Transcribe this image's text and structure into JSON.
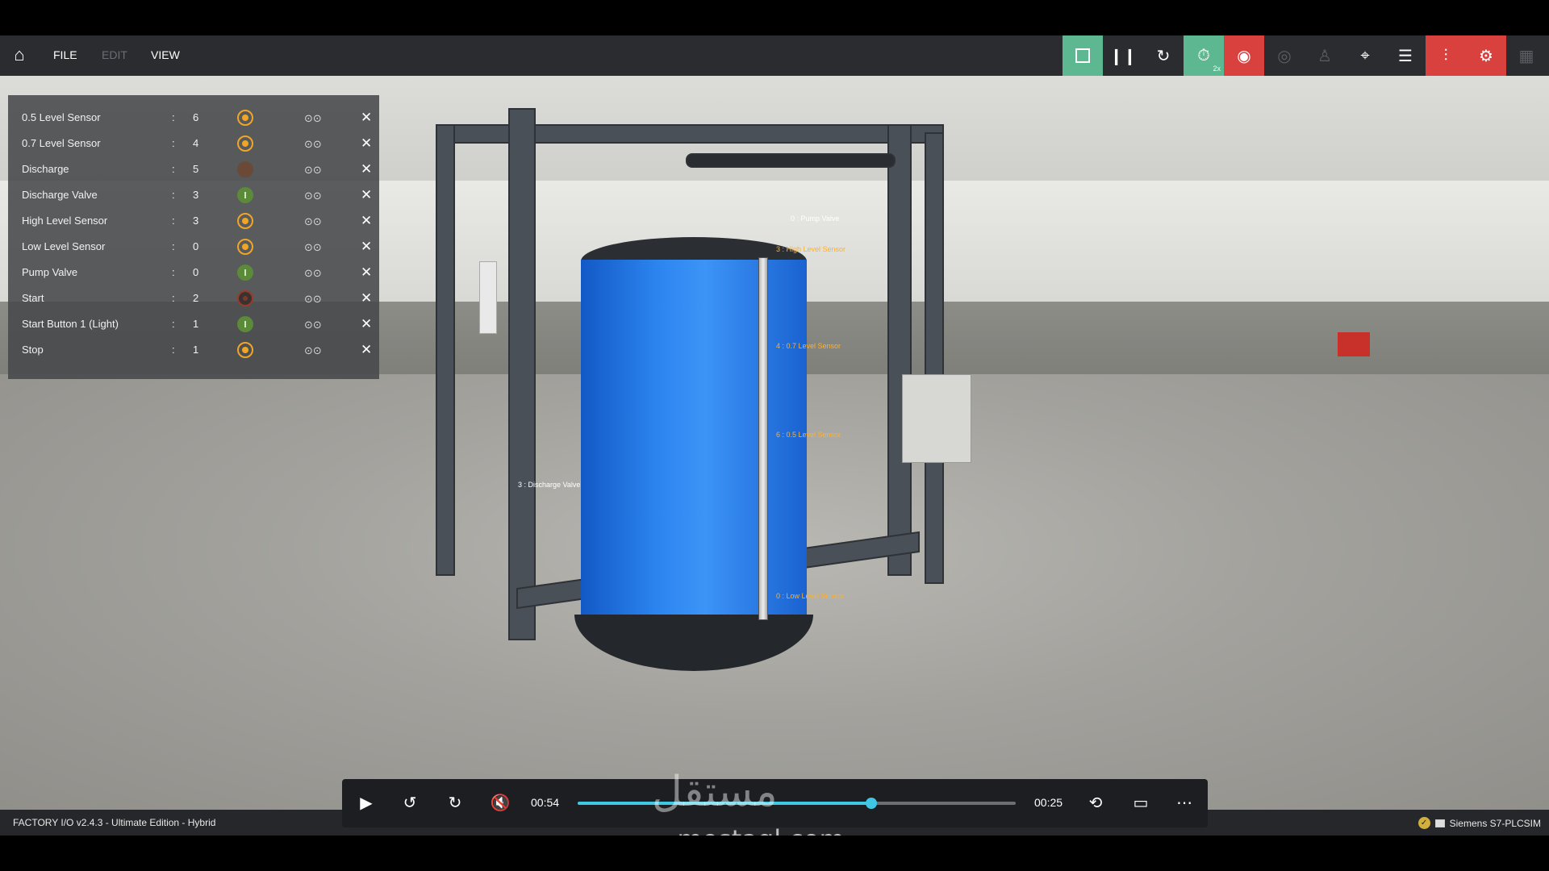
{
  "toolbar": {
    "menus": [
      {
        "label": "FILE",
        "enabled": true
      },
      {
        "label": "EDIT",
        "enabled": false
      },
      {
        "label": "VIEW",
        "enabled": true
      }
    ],
    "speed_badge": "2x",
    "accent_green": "#5db891",
    "accent_red": "#d9413f"
  },
  "tags": [
    {
      "name": "0.5 Level Sensor",
      "value": "6",
      "indicator": "orange"
    },
    {
      "name": "0.7 Level Sensor",
      "value": "4",
      "indicator": "orange"
    },
    {
      "name": "Discharge",
      "value": "5",
      "indicator": "off"
    },
    {
      "name": "Discharge Valve",
      "value": "3",
      "indicator": "green"
    },
    {
      "name": "High Level Sensor",
      "value": "3",
      "indicator": "orange"
    },
    {
      "name": "Low Level Sensor",
      "value": "0",
      "indicator": "orange"
    },
    {
      "name": "Pump Valve",
      "value": "0",
      "indicator": "green"
    },
    {
      "name": "Start",
      "value": "2",
      "indicator": "off-ring"
    },
    {
      "name": "Start Button 1 (Light)",
      "value": "1",
      "indicator": "green"
    },
    {
      "name": "Stop",
      "value": "1",
      "indicator": "orange"
    }
  ],
  "scene_labels": {
    "pump_valve": "0 : Pump Valve",
    "high_level": "3 : High Level Sensor",
    "level_07": "4 : 0.7 Level Sensor",
    "level_05": "6 : 0.5 Level Sensor",
    "low_level": "0 : Low Level Sensor",
    "discharge_valve": "3 : Discharge Valve"
  },
  "player": {
    "current_time": "00:54",
    "remaining_time": "00:25",
    "progress": 0.67
  },
  "status": {
    "app_version": "FACTORY I/O v2.4.3 - Ultimate Edition - Hybrid",
    "driver": "Siemens S7-PLCSIM"
  },
  "watermark": {
    "logo": "مستقل",
    "url": "mostaql.com"
  }
}
